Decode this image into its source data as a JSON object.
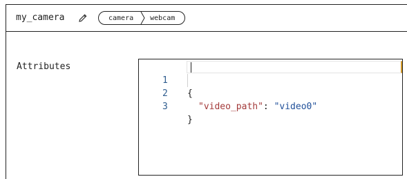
{
  "header": {
    "title": "my_camera",
    "edit_icon": "pencil-icon",
    "breadcrumb": [
      "camera",
      "webcam"
    ]
  },
  "attributes": {
    "label": "Attributes",
    "editor": {
      "line_numbers": [
        "1",
        "2",
        "3"
      ],
      "open_brace": "{",
      "key": "\"video_path\"",
      "colon": ": ",
      "value": "\"video0\"",
      "close_brace": "}"
    }
  },
  "colors": {
    "line_number": "#2f5d8f",
    "json_key": "#a33a3a",
    "json_string": "#1f4f99",
    "cursor_accent": "#d49a2a"
  }
}
